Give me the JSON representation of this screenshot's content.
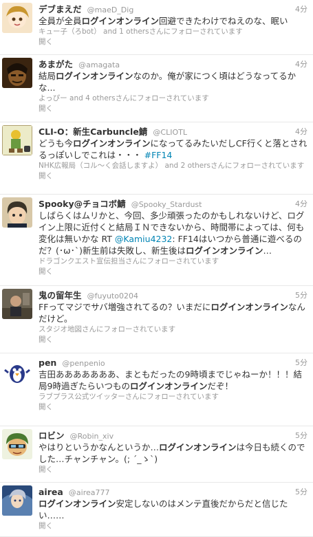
{
  "tweets": [
    {
      "name": "デブまえだ",
      "handle": "@maeD_Dig",
      "time": "4分",
      "text_segments": [
        {
          "t": "全員が全員"
        },
        {
          "t": "ログインオンライン",
          "b": true
        },
        {
          "t": "回避できたわけでねえのな、眠い"
        }
      ],
      "follow": "キュー子（ろbot） and 1 othersさんにフォローされています",
      "open": "開く",
      "avatar_color": "#f3d9b8"
    },
    {
      "name": "あまがた",
      "handle": "@amagata",
      "time": "4分",
      "text_segments": [
        {
          "t": "結局"
        },
        {
          "t": "ログインオンライン",
          "b": true
        },
        {
          "t": "なのか。俺が家につく頃はどうなってるかな..."
        }
      ],
      "follow": "よっぴー and 4 othersさんにフォローされています",
      "open": "開く",
      "avatar_color": "#4a2e12"
    },
    {
      "name": "CLI-O：新生Carbuncle鯖",
      "handle": "@CLIOTL",
      "time": "4分",
      "text_segments": [
        {
          "t": "どうも今"
        },
        {
          "t": "ログインオンライン",
          "b": true
        },
        {
          "t": "になってるみたいだしCF行くと落とされるっぽいしでこれは・・・ "
        },
        {
          "t": "#FF14",
          "l": true
        }
      ],
      "follow": "NHK広報局（コル〜く会話しますよ） and 2 othersさんにフォローされています",
      "open": "開く",
      "avatar_color": "#e8e8c0"
    },
    {
      "name": "Spooky@チョコボ鯖",
      "handle": "@Spooky_Stardust",
      "time": "4分",
      "text_segments": [
        {
          "t": "しばらくはムリかと、今回、多少頑張ったのかもしれないけど、ログイン上限に近付くと結局ＩＮできないから、時間帯によっては、何も変化は無いかな RT "
        },
        {
          "t": "@Kamiu4232",
          "l": true
        },
        {
          "t": ": FF14はいつから普通に遊べるのだ？(･ω･`)新生前は失敗し、新生後は"
        },
        {
          "t": "ログインオンライン",
          "b": true
        },
        {
          "t": "…"
        }
      ],
      "follow": "ドラゴンクエスト宣伝担当さんにフォローされています",
      "open": "開く",
      "avatar_color": "#6b5a3a"
    },
    {
      "name": "鬼の留年生",
      "handle": "@fuyuto0204",
      "time": "5分",
      "text_segments": [
        {
          "t": "FFってマジでサバ増強されてるの？いまだに"
        },
        {
          "t": "ログインオンライン",
          "b": true
        },
        {
          "t": "なんだけど。"
        }
      ],
      "follow": "スタジオ地図さんにフォローされています",
      "open": "開く",
      "avatar_color": "#5a5040"
    },
    {
      "name": "pen",
      "handle": "@penpenio",
      "time": "5分",
      "text_segments": [
        {
          "t": "吉田あああああああ、まともだったの9時頃までじゃねーか！！！結局9時過ぎたらいつもの"
        },
        {
          "t": "ログインオンライン",
          "b": true
        },
        {
          "t": "だぞ！"
        }
      ],
      "follow": "ラブプラス公式ツイッターさんにフォローされています",
      "open": "開く",
      "avatar_color": "#ffffff"
    },
    {
      "name": "ロビン",
      "handle": "@Robin_xiv",
      "time": "5分",
      "text_segments": [
        {
          "t": "やはりというかなんというか…"
        },
        {
          "t": "ログインオンライン",
          "b": true
        },
        {
          "t": "は今日も続くのでした…チャンチャン。(; ´_ゝ`)"
        }
      ],
      "follow": "",
      "open": "開く",
      "avatar_color": "#e0e8d0"
    },
    {
      "name": "airea",
      "handle": "@airea777",
      "time": "5分",
      "text_segments": [
        {
          "t": "ログインオンライン",
          "b": true
        },
        {
          "t": "安定しないのはメンテ直後だからだと信じたい……"
        }
      ],
      "follow": "",
      "open": "開く",
      "avatar_color": "#3a5a8a"
    }
  ]
}
